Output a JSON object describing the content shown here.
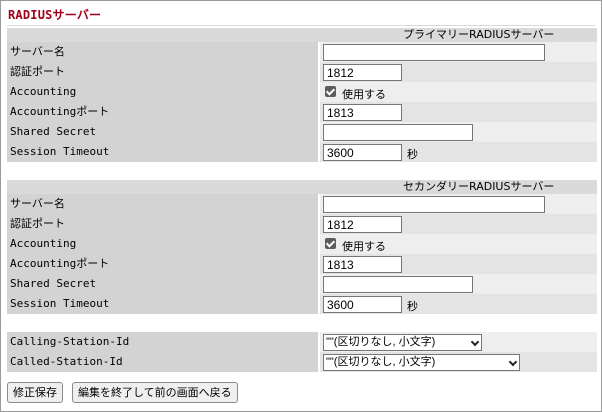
{
  "page": {
    "title": "RADIUSサーバー"
  },
  "primary": {
    "header": "プライマリーRADIUSサーバー",
    "server_name_label": "サーバー名",
    "server_name_value": "",
    "auth_port_label": "認証ポート",
    "auth_port_value": "1812",
    "accounting_label": "Accounting",
    "accounting_checked": true,
    "accounting_checkbox_label": "使用する",
    "accounting_port_label": "Accountingポート",
    "accounting_port_value": "1813",
    "shared_secret_label": "Shared Secret",
    "shared_secret_value": "",
    "session_timeout_label": "Session Timeout",
    "session_timeout_value": "3600",
    "session_timeout_unit": "秒"
  },
  "secondary": {
    "header": "セカンダリーRADIUSサーバー",
    "server_name_label": "サーバー名",
    "server_name_value": "",
    "auth_port_label": "認証ポート",
    "auth_port_value": "1812",
    "accounting_label": "Accounting",
    "accounting_checked": true,
    "accounting_checkbox_label": "使用する",
    "accounting_port_label": "Accountingポート",
    "accounting_port_value": "1813",
    "shared_secret_label": "Shared Secret",
    "shared_secret_value": "",
    "session_timeout_label": "Session Timeout",
    "session_timeout_value": "3600",
    "session_timeout_unit": "秒"
  },
  "station": {
    "calling_label": "Calling-Station-Id",
    "calling_value": "\"\"(区切りなし, 小文字)",
    "called_label": "Called-Station-Id",
    "called_value": "\"\"(区切りなし, 小文字)"
  },
  "buttons": {
    "save_label": "修正保存",
    "exit_label": "編集を終了して前の画面へ戻る"
  }
}
